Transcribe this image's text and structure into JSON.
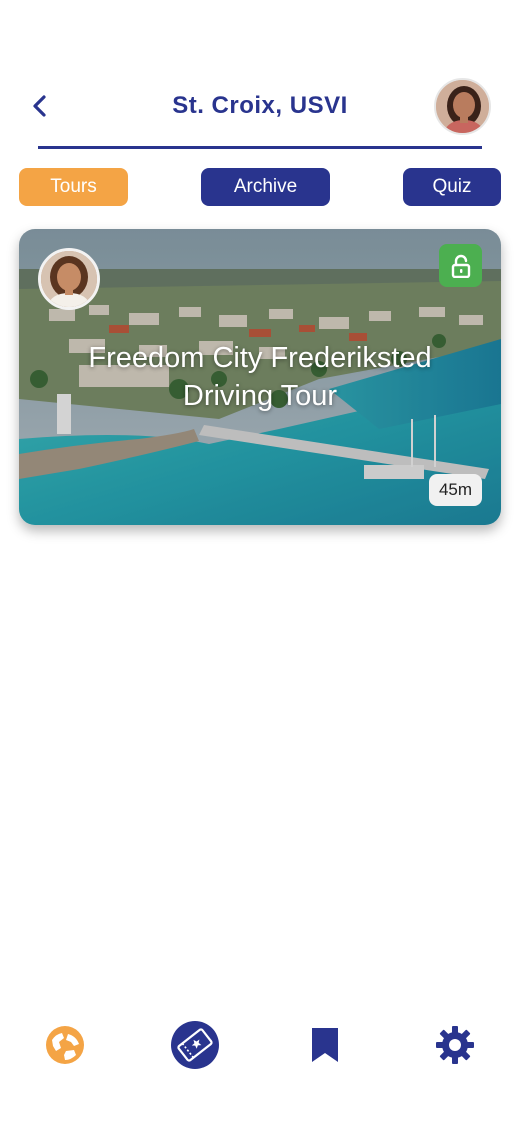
{
  "header": {
    "title": "St. Croix, USVI",
    "back_icon": "chevron-left-icon",
    "avatar": "guide-avatar"
  },
  "tabs": [
    {
      "label": "Tours",
      "active": true
    },
    {
      "label": "Archive",
      "active": false
    },
    {
      "label": "Quiz",
      "active": false
    }
  ],
  "tours": [
    {
      "title": "Freedom City Frederiksted Driving Tour",
      "duration": "45m",
      "status_icon": "unlocked-icon"
    }
  ],
  "bottom_nav": [
    {
      "icon": "globe-icon",
      "active": true
    },
    {
      "icon": "ticket-icon",
      "active": false
    },
    {
      "icon": "bookmark-icon",
      "active": false
    },
    {
      "icon": "gear-icon",
      "active": false
    }
  ],
  "colors": {
    "primary": "#29348e",
    "accent": "#f4a445",
    "success": "#4caf50"
  }
}
